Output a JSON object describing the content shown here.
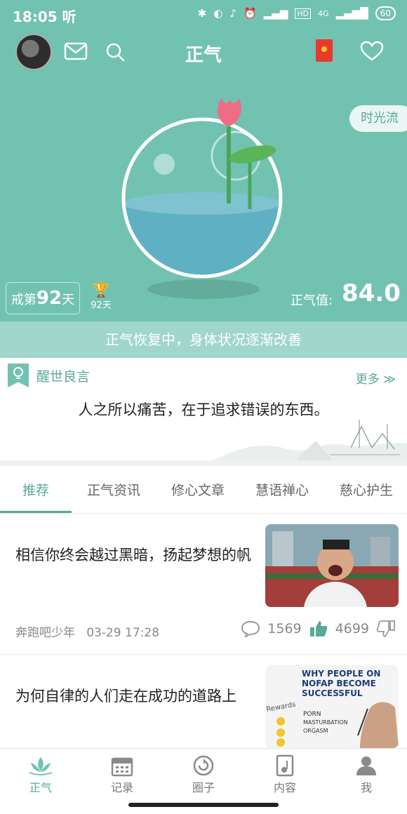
{
  "status_bar": {
    "time": "18:05",
    "time_suffix": "听",
    "network": "4G",
    "battery": "60"
  },
  "header": {
    "title": "正气"
  },
  "hero": {
    "time_flow_label": "时光流",
    "streak_prefix": "戒第",
    "streak_days": "92",
    "streak_suffix": "天",
    "trophy_label": "92天",
    "score_label": "正气值:",
    "score_value": "84.0",
    "status_message": "正气恢复中，身体状况逐渐改善"
  },
  "quote": {
    "title": "醒世良言",
    "more_label": "更多 ≫",
    "text": "人之所以痛苦，在于追求错误的东西。"
  },
  "tabs": [
    {
      "label": "推荐",
      "active": true
    },
    {
      "label": "正气资讯",
      "active": false
    },
    {
      "label": "修心文章",
      "active": false
    },
    {
      "label": "慧语禅心",
      "active": false
    },
    {
      "label": "慈心护生",
      "active": false
    }
  ],
  "articles": [
    {
      "title": "相信你终会越过黑暗，扬起梦想的帆",
      "author": "奔跑吧少年",
      "date": "03-29 17:28",
      "comments": "1569",
      "likes": "4699"
    },
    {
      "title": "为何自律的人们走在成功的道路上",
      "thumb_text": [
        "WHY PEOPLE ON",
        "NOFAP BECOME",
        "SUCCESSFUL"
      ],
      "thumb_notes": [
        "Rewards",
        "PORN",
        "MASTURBATION",
        "ORGASM"
      ]
    }
  ],
  "bottom_nav": [
    {
      "label": "正气",
      "icon": "lotus-icon",
      "active": true
    },
    {
      "label": "记录",
      "icon": "calendar-icon",
      "active": false
    },
    {
      "label": "圈子",
      "icon": "circle-refresh-icon",
      "active": false
    },
    {
      "label": "内容",
      "icon": "music-book-icon",
      "active": false
    },
    {
      "label": "我",
      "icon": "person-icon",
      "active": false
    }
  ],
  "colors": {
    "accent": "#72c2b1",
    "accent_dark": "#5aa898",
    "band": "#a0d6cb",
    "trophy": "#f2c530"
  }
}
